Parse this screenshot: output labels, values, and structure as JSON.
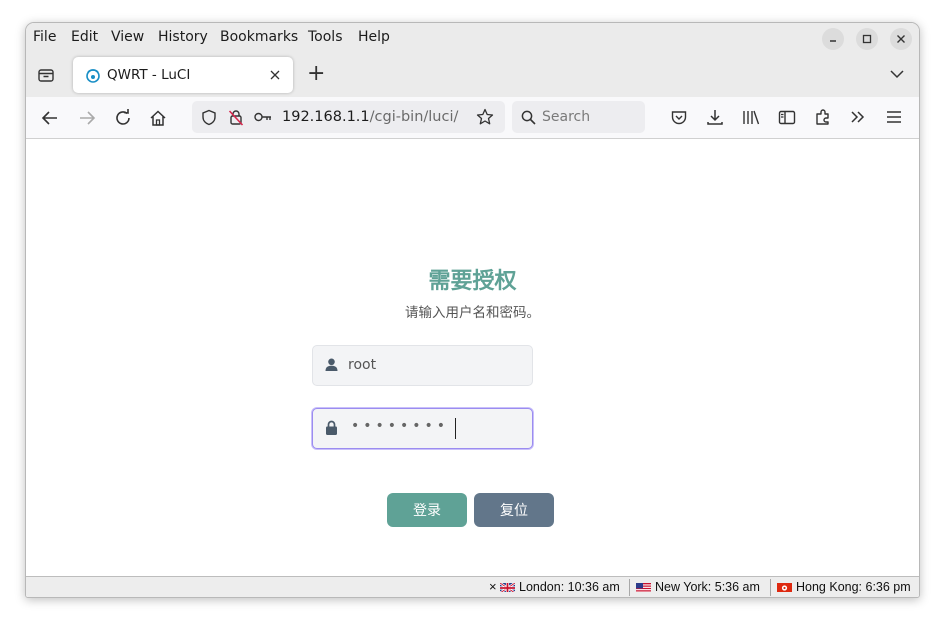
{
  "menu": {
    "items": [
      "File",
      "Edit",
      "View",
      "History",
      "Bookmarks",
      "Tools",
      "Help"
    ]
  },
  "tab": {
    "title": "QWRT - LuCI",
    "new_tab": "+"
  },
  "url": {
    "host": "192.168.1.1",
    "path": "/cgi-bin/luci/"
  },
  "search": {
    "placeholder": "Search"
  },
  "login": {
    "title": "需要授权",
    "subtitle": "请输入用户名和密码。",
    "username_value": "root",
    "password_dots": "••••••••",
    "login_button": "登录",
    "reset_button": "复位"
  },
  "colors": {
    "accent": "#5fa296",
    "login_button": "#5fa296",
    "reset_button": "#62768a",
    "focus_border": "#9b8cf0"
  },
  "status": {
    "close": "×",
    "clocks": [
      {
        "label": "London: 10:36 am",
        "flag": "uk-flag-icon"
      },
      {
        "label": "New York: 5:36 am",
        "flag": "us-flag-icon"
      },
      {
        "label": "Hong Kong: 6:36 pm",
        "flag": "hk-flag-icon"
      }
    ]
  }
}
